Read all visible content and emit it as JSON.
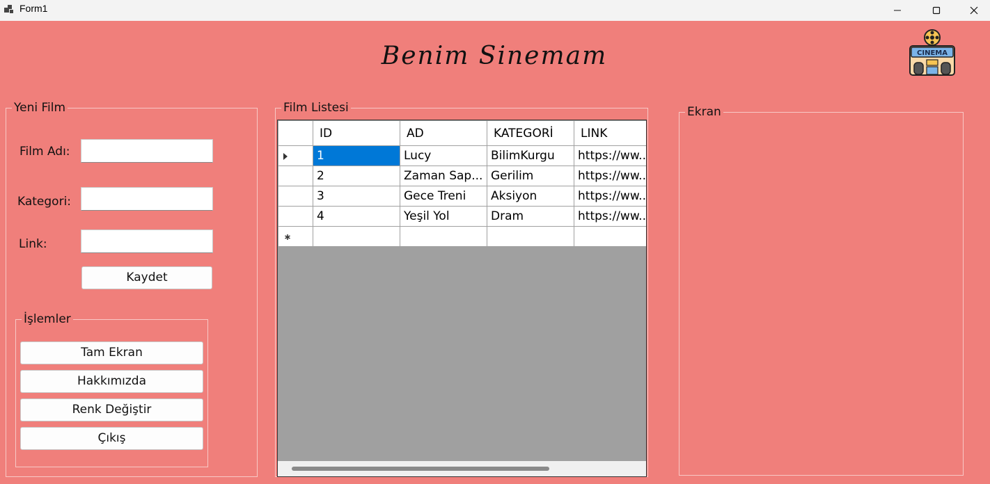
{
  "window": {
    "title": "Form1"
  },
  "app": {
    "title": "Benim Sinemam",
    "logo_text": "CINEMA"
  },
  "new_film": {
    "legend": "Yeni Film",
    "film_name_label": "Film Adı:",
    "film_name_value": "",
    "category_label": "Kategori:",
    "category_value": "",
    "link_label": "Link:",
    "link_value": "",
    "save_label": "Kaydet"
  },
  "operations": {
    "legend": "İşlemler",
    "fullscreen_label": "Tam Ekran",
    "about_label": "Hakkımızda",
    "change_color_label": "Renk Değiştir",
    "exit_label": "Çıkış"
  },
  "film_list": {
    "legend": "Film Listesi",
    "columns": [
      "ID",
      "AD",
      "KATEGORİ",
      "LINK"
    ],
    "rows": [
      {
        "id": "1",
        "ad": "Lucy",
        "kategori": "BilimKurgu",
        "link": "https://ww..."
      },
      {
        "id": "2",
        "ad": "Zaman Sap...",
        "kategori": "Gerilim",
        "link": "https://ww..."
      },
      {
        "id": "3",
        "ad": "Gece Treni",
        "kategori": "Aksiyon",
        "link": "https://ww..."
      },
      {
        "id": "4",
        "ad": "Yeşil Yol",
        "kategori": "Dram",
        "link": "https://ww..."
      }
    ]
  },
  "screen": {
    "legend": "Ekran"
  },
  "colors": {
    "background": "#f07f7b",
    "selection": "#0078d7",
    "grid_empty": "#a0a0a0"
  }
}
